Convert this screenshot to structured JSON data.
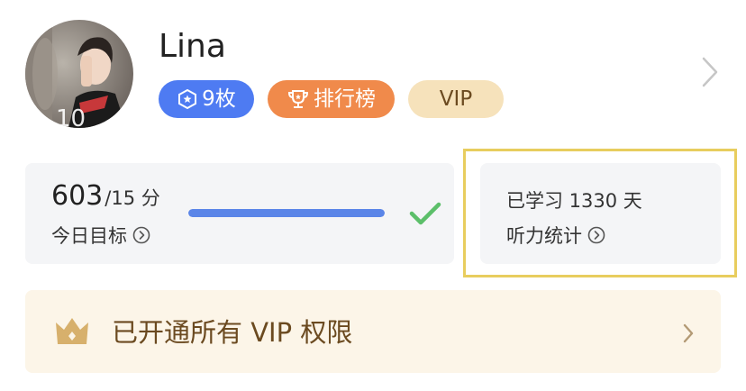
{
  "profile": {
    "name": "Lina",
    "avatar_icon": "user-photo-avatar"
  },
  "badges": {
    "medals": "9枚",
    "leaderboard": "排行榜",
    "vip": "VIP"
  },
  "goal": {
    "score": "603",
    "target": "/15 分",
    "label": "今日目标",
    "progress_fraction": 1.0,
    "completed": true
  },
  "stats": {
    "days_studied": "已学习 1330 天",
    "listening_label": "听力统计"
  },
  "vip_banner": {
    "text": "已开通所有 VIP 权限"
  },
  "colors": {
    "accent_blue": "#4e7bf2",
    "rank_orange": "#f08a4b",
    "vip_gold": "#f6e2bb",
    "check_green": "#5cbf6a",
    "highlight_yellow": "#e8cd5e"
  }
}
